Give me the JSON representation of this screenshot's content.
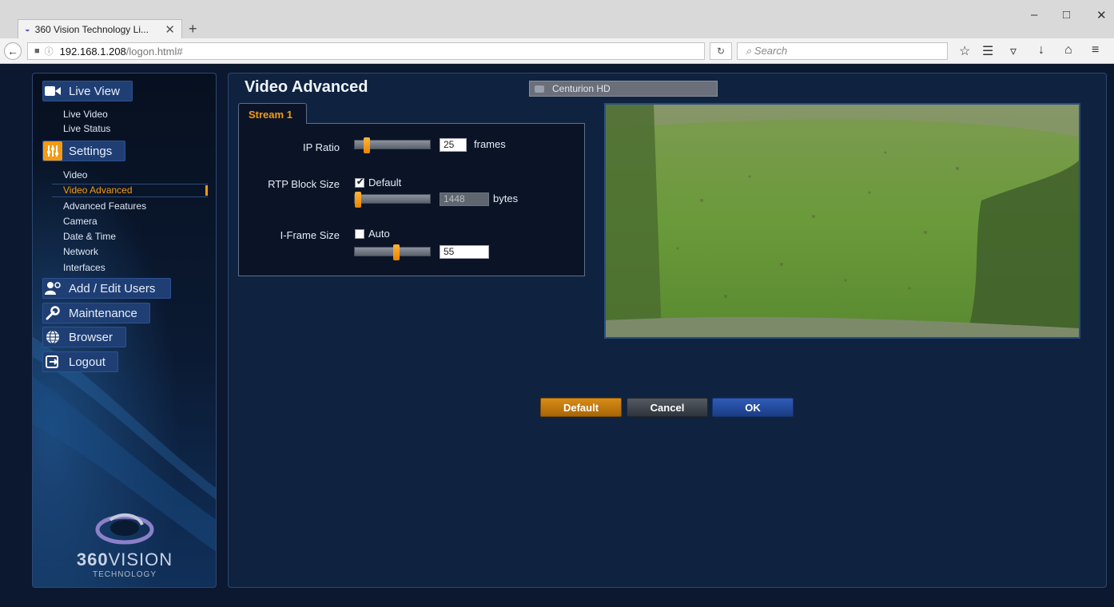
{
  "browser": {
    "tab_title": "360 Vision Technology Li...",
    "new_tab": "+",
    "url_host": "192.168.1.208",
    "url_path": "/logon.html#",
    "search_placeholder": "Search"
  },
  "sidebar": {
    "sections": [
      {
        "label": "Live View",
        "icon": "video-camera-icon"
      },
      {
        "label": "Settings",
        "icon": "sliders-icon"
      },
      {
        "label": "Add / Edit Users",
        "icon": "add-user-icon"
      },
      {
        "label": "Maintenance",
        "icon": "wrench-icon"
      },
      {
        "label": "Browser",
        "icon": "globe-icon"
      },
      {
        "label": "Logout",
        "icon": "logout-icon"
      }
    ],
    "live_view_items": [
      "Live Video",
      "Live Status"
    ],
    "settings_items": [
      "Video",
      "Video Advanced",
      "Advanced Features",
      "Camera",
      "Date & Time",
      "Network",
      "Interfaces"
    ],
    "active_item": "Video Advanced",
    "logo": {
      "bold": "360",
      "thin": "VISION",
      "sub": "TECHNOLOGY"
    }
  },
  "main": {
    "title": "Video Advanced",
    "camera_name": "Centurion HD",
    "tab": "Stream 1",
    "ip_ratio": {
      "label": "IP Ratio",
      "value": "25",
      "unit": "frames",
      "slider_fraction": 0.12
    },
    "rtp_block_size": {
      "label": "RTP Block Size",
      "default_checked": true,
      "default_label": "Default",
      "value": "1448",
      "unit": "bytes",
      "slider_fraction": 0.0
    },
    "iframe_size": {
      "label": "I-Frame Size",
      "auto_checked": false,
      "auto_label": "Auto",
      "value": "55",
      "slider_fraction": 0.55
    },
    "buttons": {
      "default": "Default",
      "cancel": "Cancel",
      "ok": "OK"
    }
  },
  "colors": {
    "accent_orange": "#f59a12",
    "ok_blue": "#1f4aa0",
    "panel_navy": "#0f2340"
  }
}
